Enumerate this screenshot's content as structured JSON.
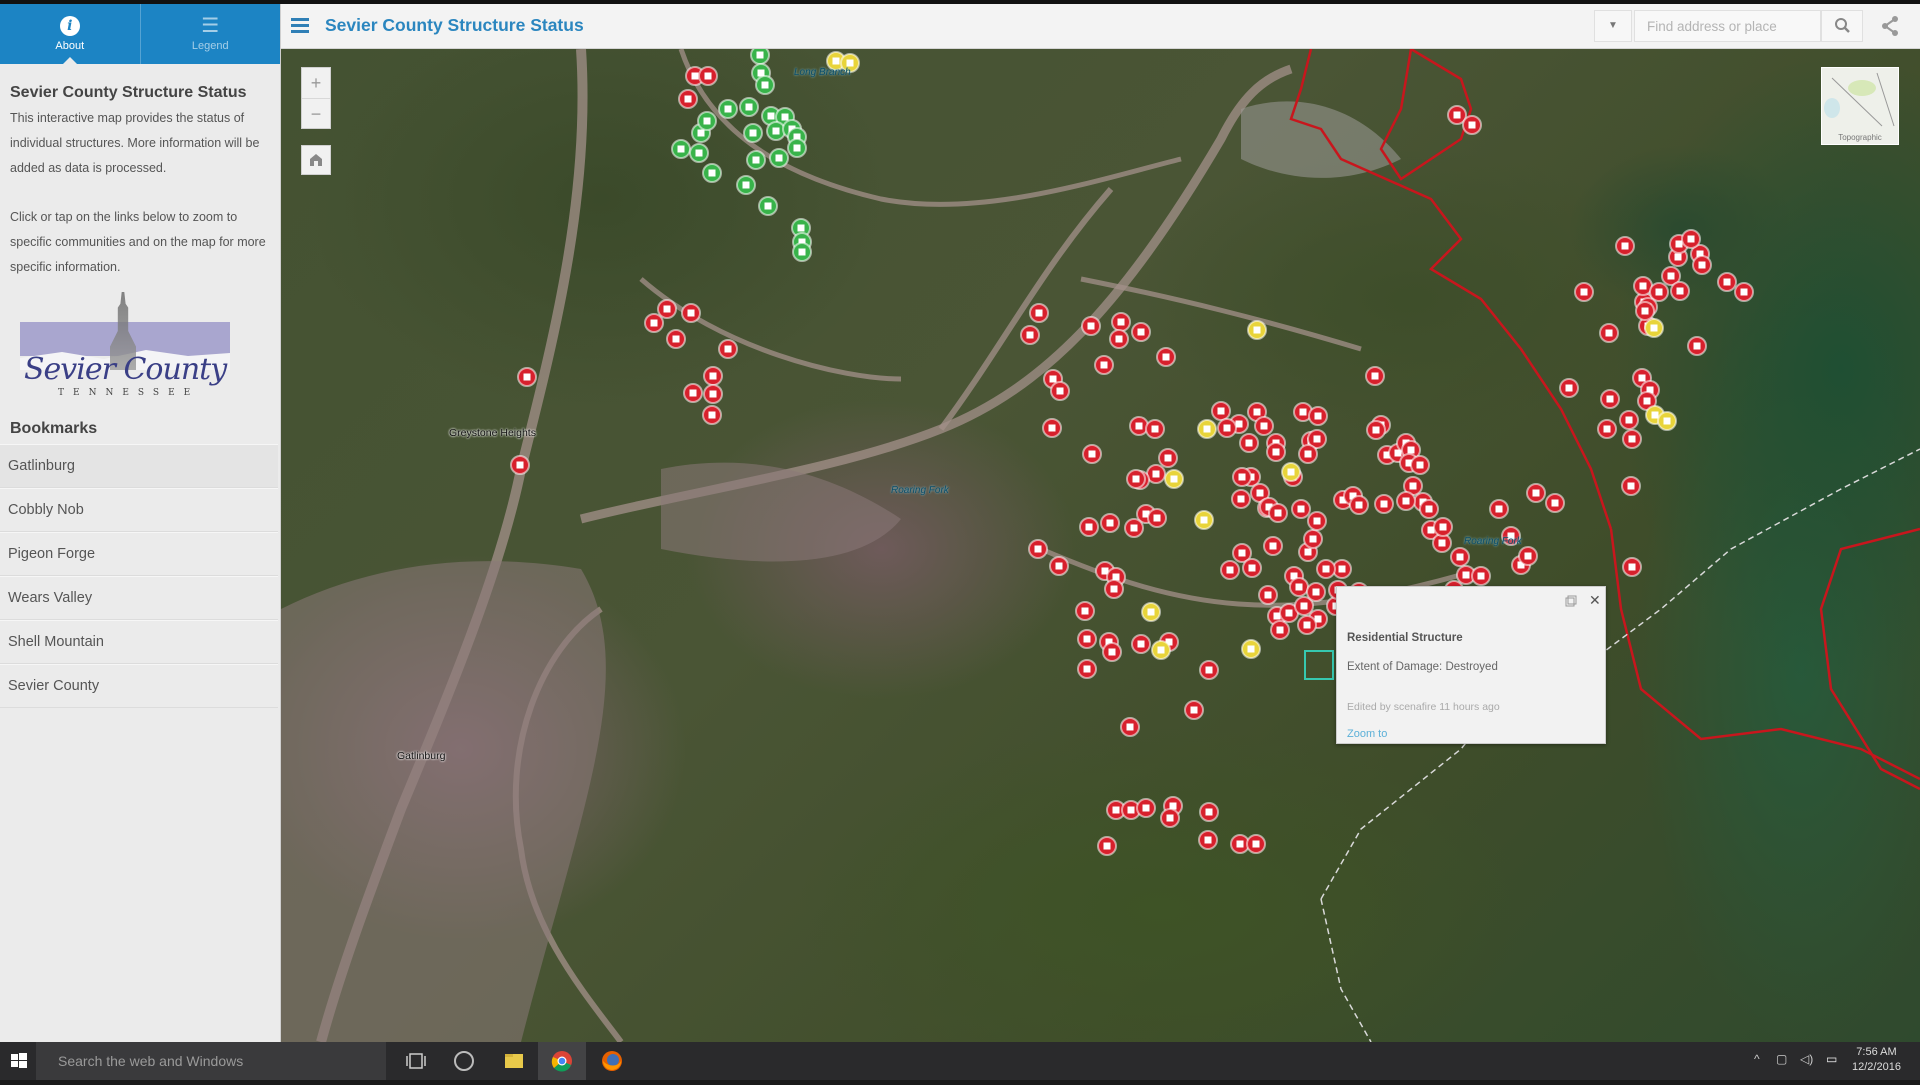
{
  "app": {
    "title": "Sevier County Structure Status"
  },
  "sidebar": {
    "tabs": [
      {
        "label": "About",
        "icon": "info-icon",
        "active": true
      },
      {
        "label": "Legend",
        "icon": "legend-list-icon",
        "active": false
      }
    ],
    "about": {
      "title": "Sevier County Structure Status",
      "paragraph1": "This interactive map provides the status of individual structures. More information will be added as data is processed.",
      "paragraph2": "Click or tap on the links below to zoom to specific communities and on the map for more specific information.",
      "logo": {
        "script_text": "Sevier County",
        "state_text": "TENNESSEE"
      }
    },
    "bookmarks": {
      "title": "Bookmarks",
      "items": [
        "Gatlinburg",
        "Cobbly Nob",
        "Pigeon Forge",
        "Wears Valley",
        "Shell Mountain",
        "Sevier County"
      ]
    }
  },
  "header": {
    "search": {
      "placeholder": "Find address or place",
      "value": ""
    },
    "dropdown_icon": "caret-down-icon",
    "search_icon": "search-icon",
    "share_icon": "share-icon"
  },
  "map": {
    "zoom_in_label": "+",
    "zoom_out_label": "−",
    "home_icon": "home-icon",
    "basemap_label": "Topographic",
    "place_labels": [
      {
        "text": "Greystone Heights"
      },
      {
        "text": "Gatlinburg"
      }
    ],
    "water_labels": [
      {
        "text": "Long Branch"
      },
      {
        "text": "Roaring Fork"
      },
      {
        "text": "Roaring Fork"
      }
    ],
    "status_colors": {
      "destroyed": "#d7202c",
      "damaged": "#e8d43a",
      "no_damage": "#38b34a",
      "fire_perimeter": "#c8161d"
    },
    "popup": {
      "title": "Residential Structure",
      "field": "Extent of Damage: Destroyed",
      "edit_info": "Edited by scenafire 11 hours ago",
      "zoom_link": "Zoom to"
    }
  },
  "taskbar": {
    "search_placeholder": "Search the web and Windows",
    "apps": [
      "task-view-icon",
      "cortana-icon",
      "file-explorer-icon",
      "chrome-icon",
      "firefox-icon"
    ],
    "time": "7:56 AM",
    "date": "12/2/2016"
  }
}
